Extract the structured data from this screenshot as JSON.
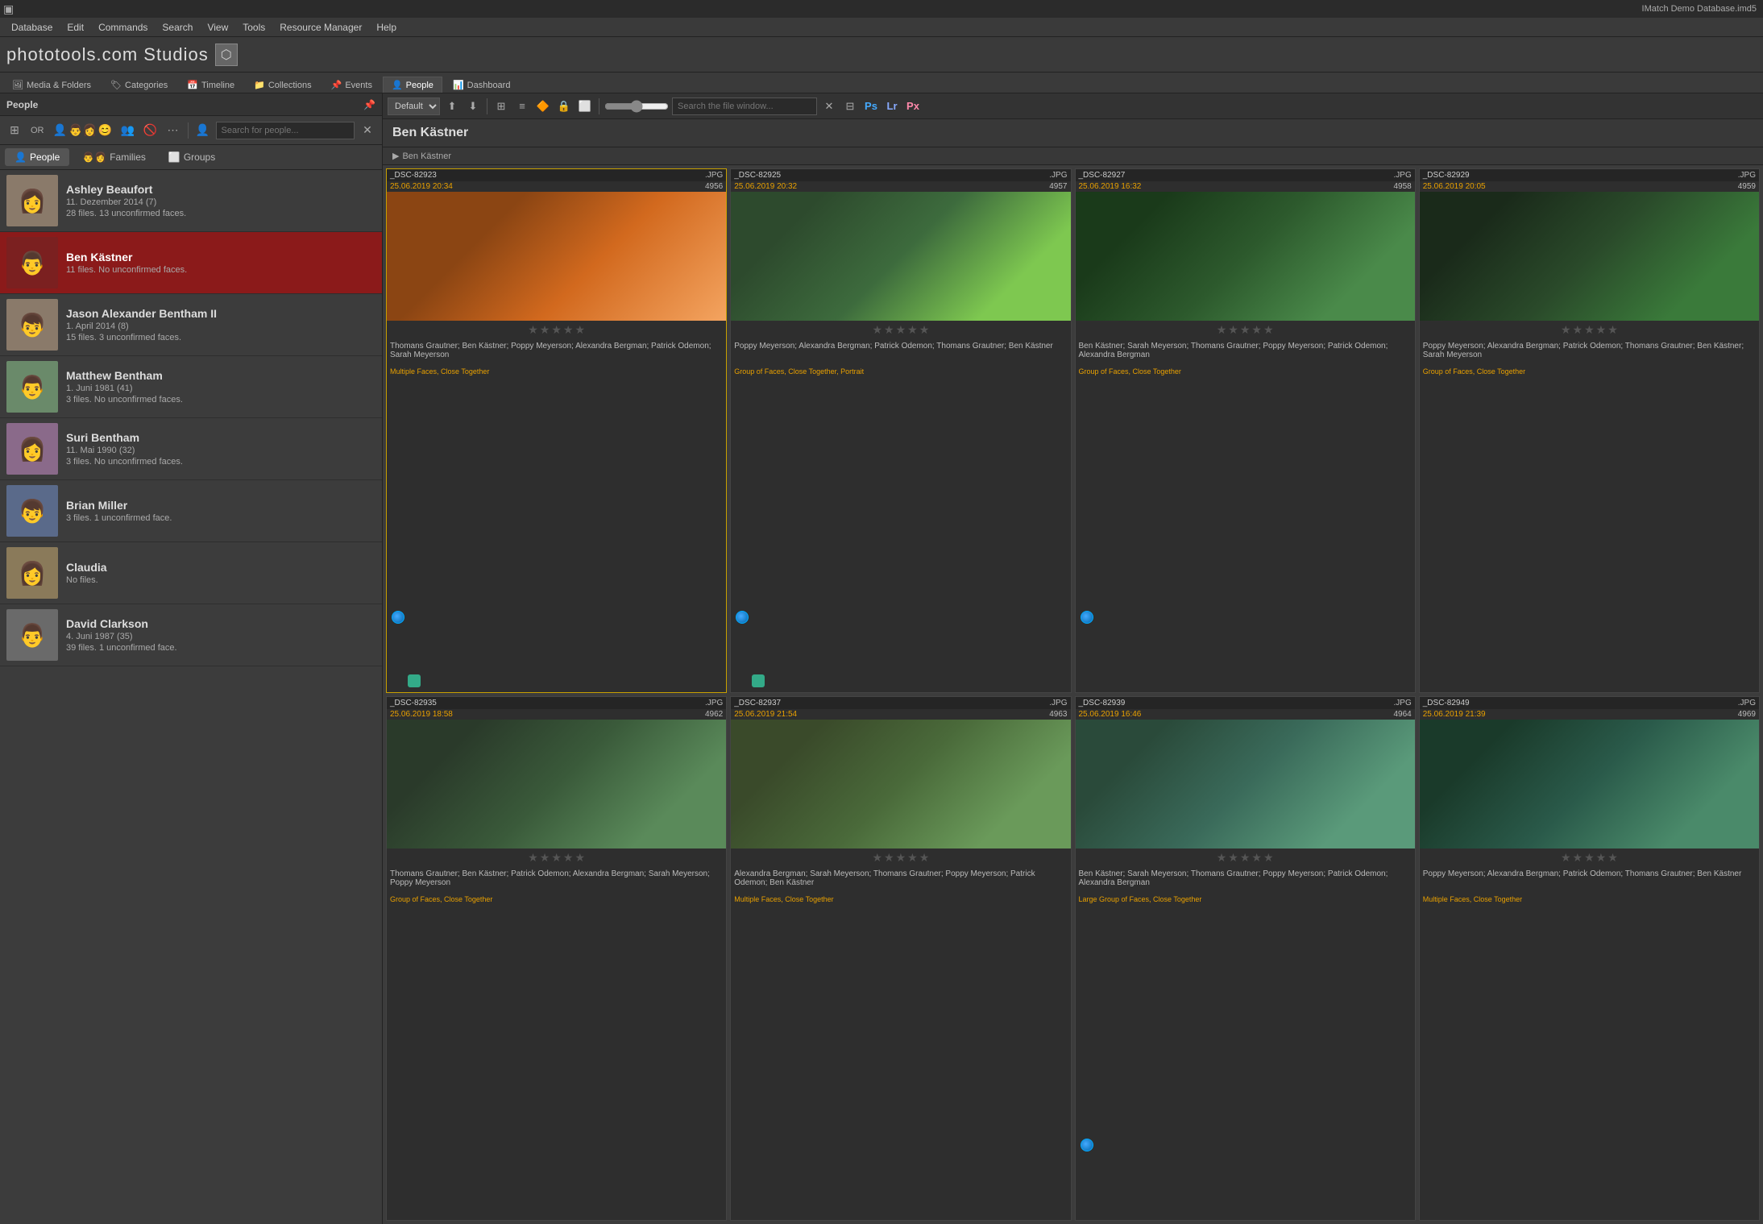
{
  "titlebar": {
    "title": "IMatch Demo Database.imd5",
    "icon": "▣"
  },
  "menubar": {
    "items": [
      "Database",
      "Edit",
      "Commands",
      "Search",
      "View",
      "Tools",
      "Resource Manager",
      "Help"
    ]
  },
  "logobar": {
    "text": "phototools.com Studios",
    "icon": "⬡"
  },
  "navtabs": {
    "items": [
      {
        "label": "Media & Folders",
        "icon": "🖼",
        "active": false
      },
      {
        "label": "Categories",
        "icon": "🏷",
        "active": false
      },
      {
        "label": "Timeline",
        "icon": "📅",
        "active": false
      },
      {
        "label": "Collections",
        "icon": "📁",
        "active": false
      },
      {
        "label": "Events",
        "icon": "📌",
        "active": false
      },
      {
        "label": "People",
        "icon": "👤",
        "active": true
      },
      {
        "label": "Dashboard",
        "icon": "📊",
        "active": false
      }
    ]
  },
  "panel": {
    "title": "People",
    "pin_label": "📌"
  },
  "people_toolbar": {
    "grid_icon": "⊞",
    "or_label": "OR",
    "add_person_icon": "👤+",
    "add_family_icon": "👨‍👩",
    "emoji_icon": "😊",
    "group_icon": "👥",
    "remove_icon": "🚫",
    "more_icon": "⋯",
    "profile_icon": "👤",
    "search_placeholder": "Search for people..."
  },
  "people_tabs": {
    "people_label": "People",
    "families_label": "Families",
    "groups_label": "Groups"
  },
  "people_list": [
    {
      "name": "Ashley Beaufort",
      "date": "11. Dezember 2014",
      "count": "(7)",
      "files_info": "28 files. 13 unconfirmed faces.",
      "avatar_color": "av-gray",
      "active": false
    },
    {
      "name": "Ben Kästner",
      "date": "",
      "count": "",
      "files_info": "11 files. No unconfirmed faces.",
      "avatar_color": "av-red",
      "active": true
    },
    {
      "name": "Jason Alexander Bentham II",
      "date": "1. April 2014",
      "count": "(8)",
      "files_info": "15 files. 3 unconfirmed faces.",
      "avatar_color": "av-gray",
      "active": false
    },
    {
      "name": "Matthew Bentham",
      "date": "1. Juni 1981",
      "count": "(41)",
      "files_info": "3 files. No unconfirmed faces.",
      "avatar_color": "av-gray",
      "active": false
    },
    {
      "name": "Suri Bentham",
      "date": "11. Mai 1990",
      "count": "(32)",
      "files_info": "3 files. No unconfirmed faces.",
      "avatar_color": "av-gray",
      "active": false
    },
    {
      "name": "Brian Miller",
      "date": "",
      "count": "",
      "files_info": "3 files. 1 unconfirmed face.",
      "avatar_color": "av-gray",
      "active": false
    },
    {
      "name": "Claudia",
      "date": "",
      "count": "",
      "files_info": "No files.",
      "avatar_color": "av-gray",
      "active": false
    },
    {
      "name": "David Clarkson",
      "date": "4. Juni 1987",
      "count": "(35)",
      "files_info": "39 files. 1 unconfirmed face.",
      "avatar_color": "av-gray",
      "active": false
    }
  ],
  "right_toolbar": {
    "sort_default": "Default",
    "search_placeholder": "Search the file window...",
    "zoom_value": 50
  },
  "selected_person": {
    "name": "Ben Kästner"
  },
  "breadcrumb": {
    "text": "Ben Kästner"
  },
  "photos": [
    {
      "filename": "_DSC-82923",
      "ext": ".JPG",
      "date": "25.06.2019 20:34",
      "number": "4956",
      "thumb_class": "thumb-1",
      "tags": "Thomans Grautner; Ben Kästner; Poppy Meyerson; Alexandra Bergman; Patrick Odemon; Sarah Meyerson",
      "labels": "Multiple Faces, Close Together",
      "selected": true,
      "has_globe": true,
      "has_chat": true
    },
    {
      "filename": "_DSC-82925",
      "ext": ".JPG",
      "date": "25.06.2019 20:32",
      "number": "4957",
      "thumb_class": "thumb-2",
      "tags": "Poppy Meyerson; Alexandra Bergman; Patrick Odemon; Thomans Grautner; Ben Kästner",
      "labels": "Group of Faces, Close Together, Portrait",
      "selected": false,
      "has_globe": true,
      "has_chat": true
    },
    {
      "filename": "_DSC-82927",
      "ext": ".JPG",
      "date": "25.06.2019 16:32",
      "number": "4958",
      "thumb_class": "thumb-3",
      "tags": "Ben Kästner; Sarah Meyerson; Thomans Grautner; Poppy Meyerson; Patrick Odemon; Alexandra Bergman",
      "labels": "Group of Faces, Close Together",
      "selected": false,
      "has_globe": true,
      "has_chat": false
    },
    {
      "filename": "_DSC-82929",
      "ext": ".JPG",
      "date": "25.06.2019 20:05",
      "number": "4959",
      "thumb_class": "thumb-4",
      "tags": "Poppy Meyerson; Alexandra Bergman; Patrick Odemon; Thomans Grautner; Ben Kästner; Sarah Meyerson",
      "labels": "Group of Faces, Close Together",
      "selected": false,
      "has_globe": false,
      "has_chat": false
    },
    {
      "filename": "_DSC-82935",
      "ext": ".JPG",
      "date": "25.06.2019 18:58",
      "number": "4962",
      "thumb_class": "thumb-5",
      "tags": "Thomans Grautner; Ben Kästner; Patrick Odemon; Alexandra Bergman; Sarah Meyerson; Poppy Meyerson",
      "labels": "Group of Faces, Close Together",
      "selected": false,
      "has_globe": false,
      "has_chat": false
    },
    {
      "filename": "_DSC-82937",
      "ext": ".JPG",
      "date": "25.06.2019 21:54",
      "number": "4963",
      "thumb_class": "thumb-6",
      "tags": "Alexandra Bergman; Sarah Meyerson; Thomans Grautner; Poppy Meyerson; Patrick Odemon; Ben Kästner",
      "labels": "Multiple Faces, Close Together",
      "selected": false,
      "has_globe": false,
      "has_chat": false
    },
    {
      "filename": "_DSC-82939",
      "ext": ".JPG",
      "date": "25.06.2019 16:46",
      "number": "4964",
      "thumb_class": "thumb-7",
      "tags": "Ben Kästner; Sarah Meyerson; Thomans Grautner; Poppy Meyerson; Patrick Odemon; Alexandra Bergman",
      "labels": "Large Group of Faces, Close Together",
      "selected": false,
      "has_globe": true,
      "has_chat": false
    },
    {
      "filename": "_DSC-82949",
      "ext": ".JPG",
      "date": "25.06.2019 21:39",
      "number": "4969",
      "thumb_class": "thumb-8",
      "tags": "Poppy Meyerson; Alexandra Bergman; Patrick Odemon; Thomans Grautner; Ben Kästner",
      "labels": "Multiple Faces, Close Together",
      "selected": false,
      "has_globe": false,
      "has_chat": false
    }
  ]
}
